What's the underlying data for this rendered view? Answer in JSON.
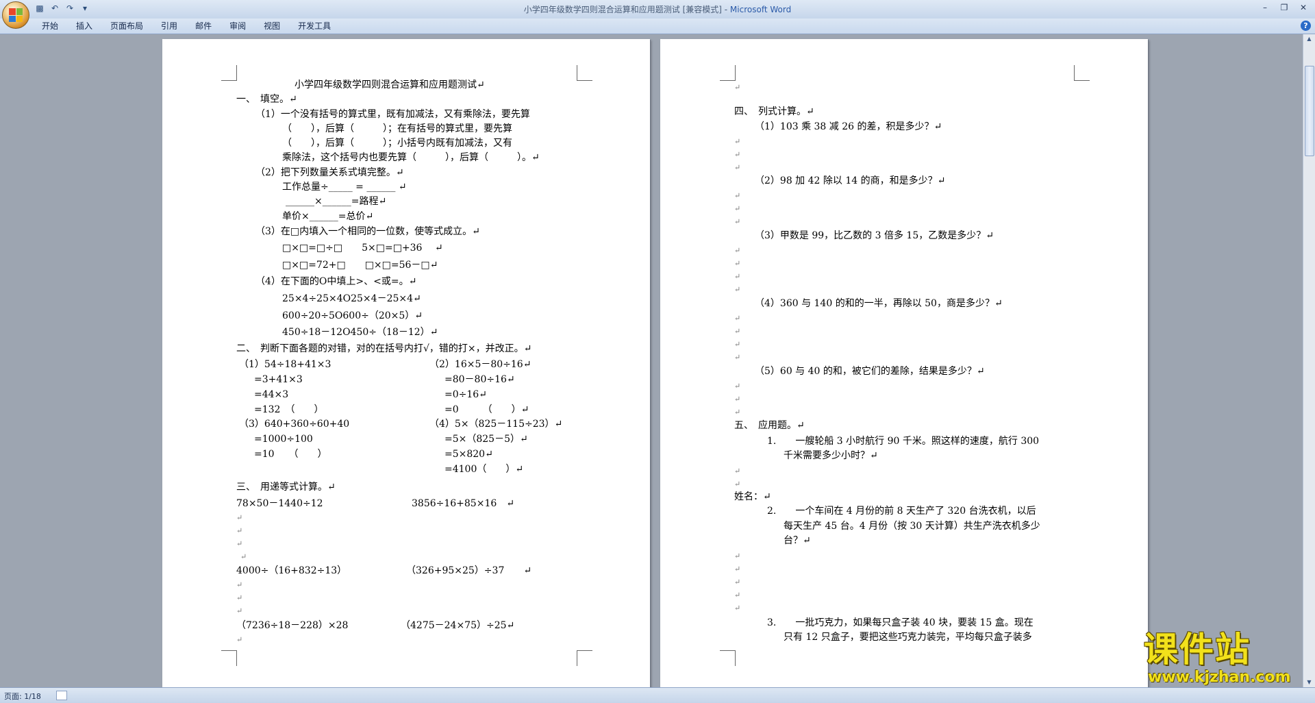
{
  "window": {
    "doc_title": "小学四年级数学四则混合运算和应用题测试 [兼容模式] - ",
    "app_name": "Microsoft Word"
  },
  "ribbon": {
    "tabs": [
      "开始",
      "插入",
      "页面布局",
      "引用",
      "邮件",
      "审阅",
      "视图",
      "开发工具"
    ]
  },
  "status": {
    "page": "页面: 1/18"
  },
  "watermark": {
    "title": "课件站",
    "url": "www.kjzhan.com"
  },
  "page1": {
    "title": "小学四年级数学四则混合运算和应用题测试↵",
    "sec1": "一、　填空。↵",
    "q1_l1": "（1）一个没有括号的算式里，既有加减法，又有乘除法，要先算",
    "q1_l2": "（　　），后算（　　　）；在有括号的算式里，要先算",
    "q1_l3": "（　　），后算（　　　）；小括号内既有加减法，又有",
    "q1_l4": "乘除法，这个括号内也要先算（　　　），后算（　　　）。↵",
    "q2": "（2）把下列数量关系式填完整。↵",
    "q2_a": "工作总量÷_____ = ______ ↵",
    "q2_b": "______×______=路程↵",
    "q2_c": "单价×______=总价↵",
    "q3": "（3）在□内填入一个相同的一位数，使等式成立。↵",
    "q3_a": "□×□=□÷□　　5×□=□+36　 ↵",
    "q3_b": "□×□=72+□　　□×□=56－□↵",
    "q4": "（4）在下面的O中填上>、<或=。↵",
    "q4_a": "25×4÷25×4O25×4－25×4↵",
    "q4_b": "600÷20÷5O600÷（20×5）↵",
    "q4_c": "450÷18－12O450÷（18－12）↵",
    "sec2": "二、　判断下面各题的对错，对的在括号内打√，错的打×，并改正。↵",
    "j1": [
      "（1）54÷18+41×3",
      "=3+41×3",
      "=44×3",
      "=132　（　　）"
    ],
    "j2": [
      "（2）16×5－80÷16↵",
      "=80－80÷16↵",
      "=0÷16↵",
      "=0　　　（　　）↵"
    ],
    "j3": [
      "（3）640+360÷60+40",
      "=1000÷100",
      "=10　　（　　）"
    ],
    "j4": [
      "（4）5×（825－115÷23）↵",
      "=5×（825－5）↵",
      "=5×820↵",
      "=4100（　　）↵"
    ],
    "sec3": "三、　用递等式计算。↵",
    "c1": "78×50－1440÷12",
    "c2": "3856÷16+85×16　↵",
    "c3": "4000÷（16+832÷13）",
    "c4": "（326+95×25）÷37　　↵",
    "c5": "（7236÷18－228）×28",
    "c6": "（4275－24×75）÷25↵",
    "mark": "↵"
  },
  "page2": {
    "sec4": "四、　列式计算。↵",
    "p1": "（1）103 乘 38 减 26 的差，积是多少？↵",
    "p2": "（2）98 加 42 除以 14 的商，和是多少？↵",
    "p3": "（3）甲数是 99，比乙数的 3 倍多 15，乙数是多少？↵",
    "p4": "（4）360 与 140 的和的一半，再除以 50，商是多少？↵",
    "p5": "（5）60 与 40 的和，被它们的差除，结果是多少？↵",
    "sec5": "五、　应用题。↵",
    "a1_l1": "1.　　一艘轮船 3 小时航行 90 千米。照这样的速度，航行 300",
    "a1_l2": "千米需要多少小时？↵",
    "name": "姓名：↵",
    "a2_l1": "2.　　一个车间在 4 月份的前 8 天生产了 320 台洗衣机，以后",
    "a2_l2": "每天生产 45 台。4 月份（按 30 天计算）共生产洗衣机多少",
    "a2_l3": "台？↵",
    "a3_l1": "3.　　一批巧克力，如果每只盒子装 40 块，要装 15 盒。现在",
    "a3_l2": "只有 12 只盒子，要把这些巧克力装完，平均每只盒子装多",
    "mark": "↵"
  }
}
